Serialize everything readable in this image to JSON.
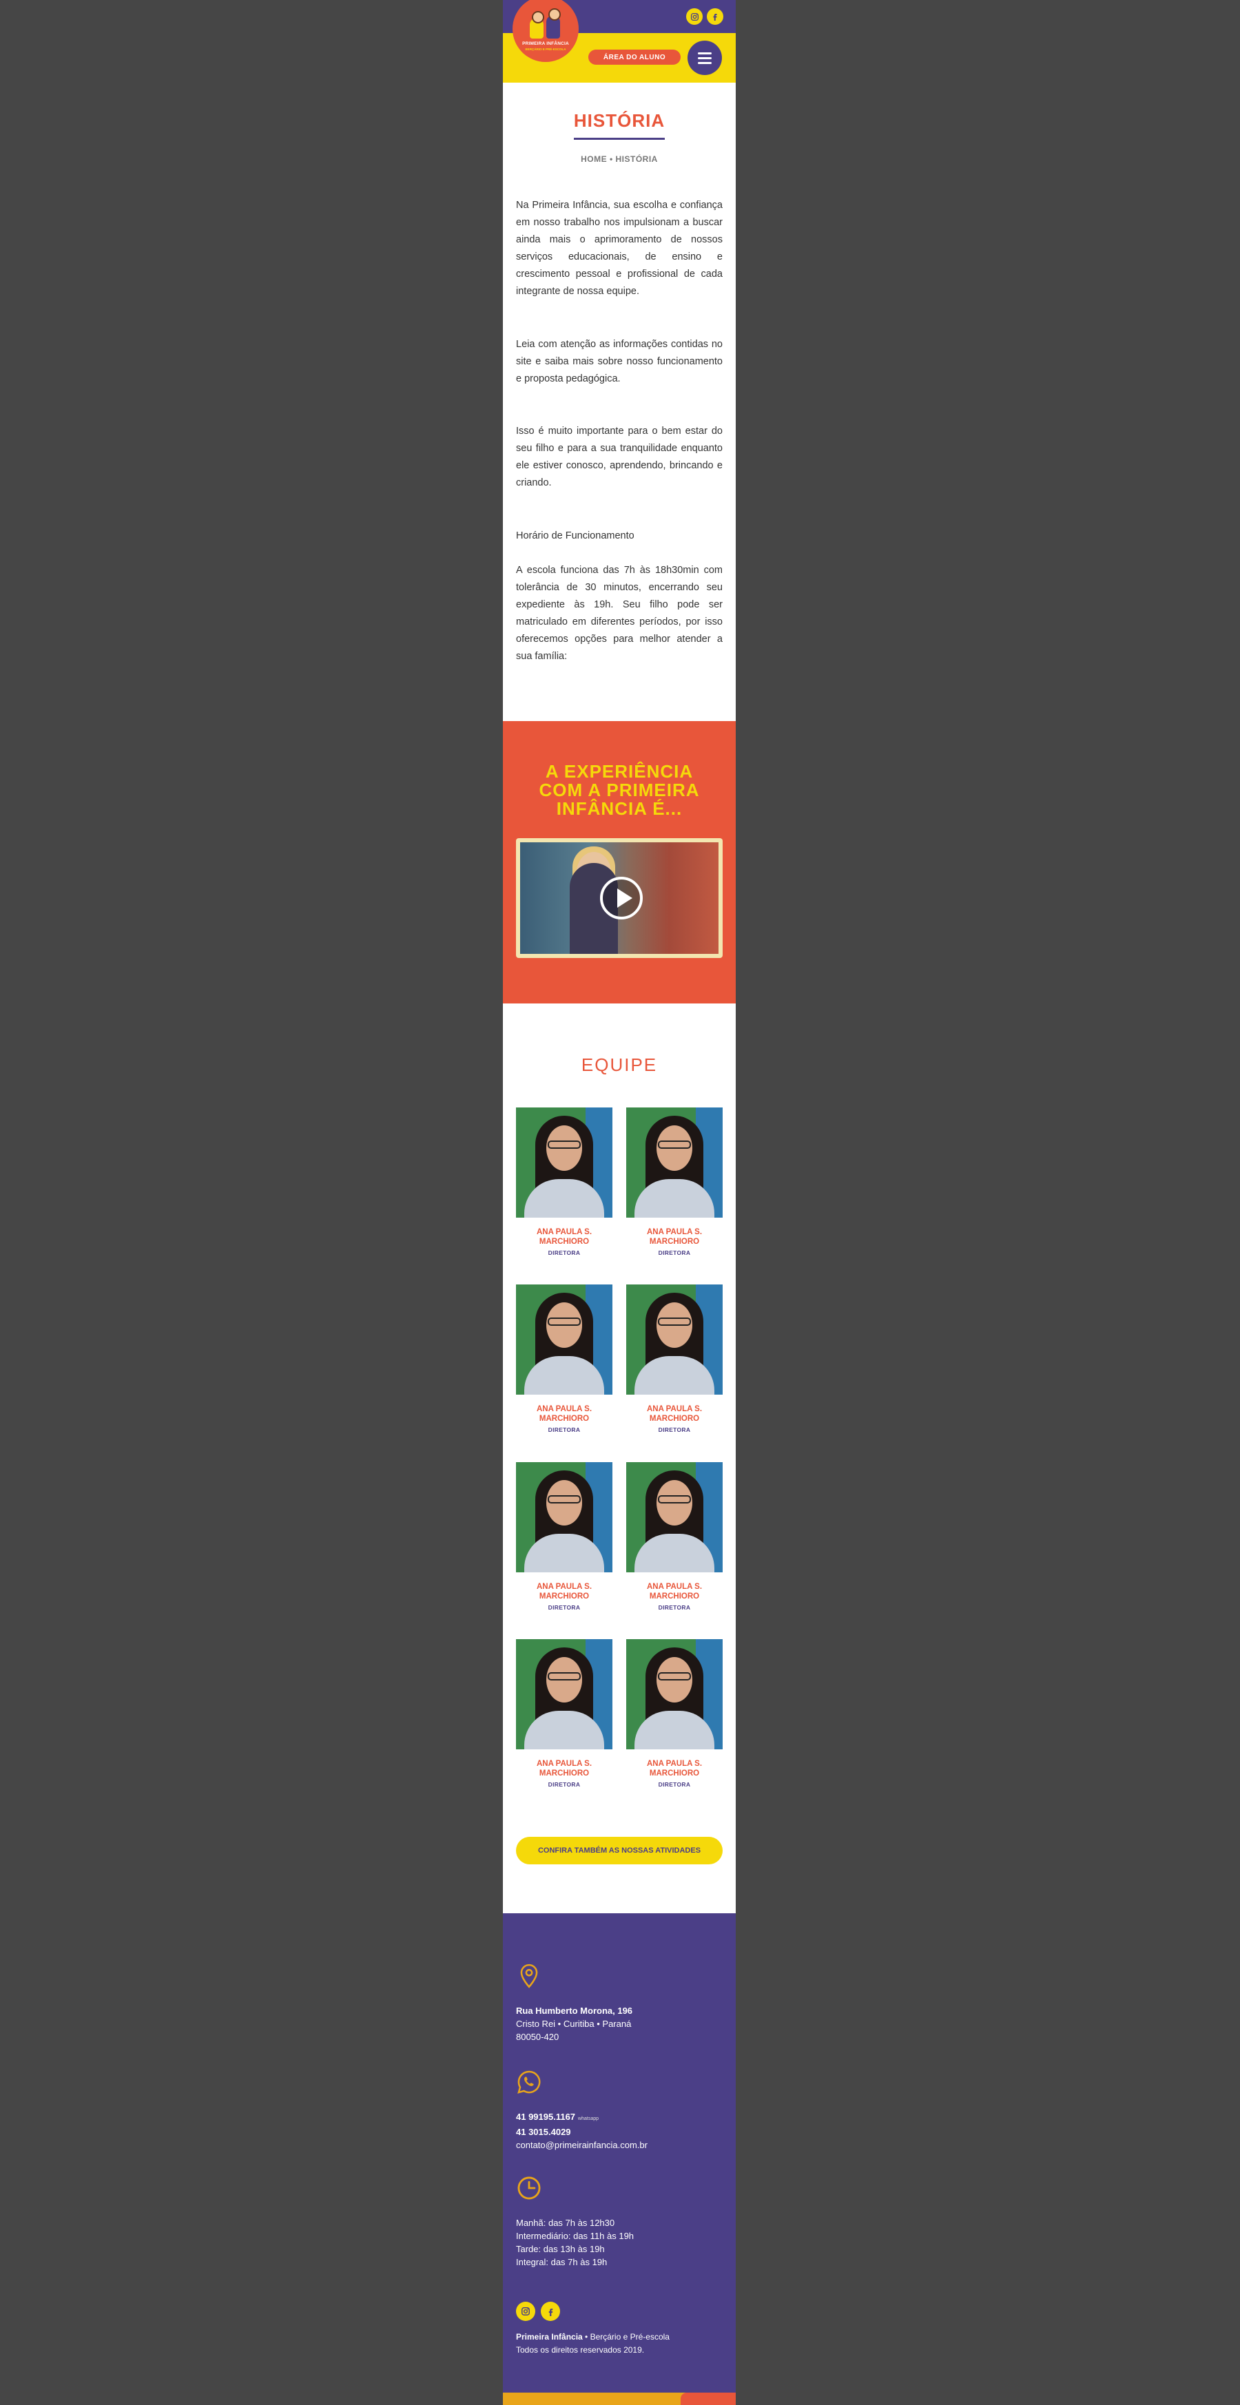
{
  "header": {
    "logo_name": "PRIMEIRA INFÂNCIA",
    "logo_sub": "BERÇÁRIO E PRÉ-ESCOLA",
    "area_button": "ÁREA DO ALUNO",
    "social": [
      "instagram-icon",
      "facebook-icon"
    ]
  },
  "historia": {
    "title": "HISTÓRIA",
    "breadcrumb": "HOME • HISTÓRIA",
    "paragraphs": [
      "Na Primeira Infância, sua escolha e confiança em nosso trabalho nos impulsionam a buscar ainda mais o aprimoramento de nossos serviços educacionais, de ensino e crescimento pessoal e profissional de cada integrante de nossa equipe.",
      "Leia com atenção as informações contidas no site e saiba mais sobre nosso funcionamento e proposta pedagógica.",
      "Isso é muito importante para o bem estar do seu filho e para a sua tranquilidade enquanto ele estiver conosco, aprendendo, brincando e criando.",
      "Horário de Funcionamento",
      "A escola funciona das 7h às 18h30min com tolerância de 30 minutos, encerrando seu expediente às 19h. Seu filho pode ser matriculado em diferentes períodos, por isso oferecemos opções para melhor atender a sua família:"
    ]
  },
  "video": {
    "title_lines": [
      "A EXPERIÊNCIA",
      "COM A PRIMEIRA",
      "INFÂNCIA É..."
    ]
  },
  "equipe": {
    "title": "EQUIPE",
    "members": [
      {
        "name_1": "ANA PAULA S.",
        "name_2": "MARCHIORO",
        "role": "DIRETORA"
      },
      {
        "name_1": "ANA PAULA S.",
        "name_2": "MARCHIORO",
        "role": "DIRETORA"
      },
      {
        "name_1": "ANA PAULA S.",
        "name_2": "MARCHIORO",
        "role": "DIRETORA"
      },
      {
        "name_1": "ANA PAULA S.",
        "name_2": "MARCHIORO",
        "role": "DIRETORA"
      },
      {
        "name_1": "ANA PAULA S.",
        "name_2": "MARCHIORO",
        "role": "DIRETORA"
      },
      {
        "name_1": "ANA PAULA S.",
        "name_2": "MARCHIORO",
        "role": "DIRETORA"
      },
      {
        "name_1": "ANA PAULA S.",
        "name_2": "MARCHIORO",
        "role": "DIRETORA"
      },
      {
        "name_1": "ANA PAULA S.",
        "name_2": "MARCHIORO",
        "role": "DIRETORA"
      }
    ],
    "activities_button": "CONFIRA TAMBÉM AS NOSSAS ATIVIDADES"
  },
  "footer": {
    "address_street": "Rua Humberto Morona, 196",
    "address_city": "Cristo Rei  •  Curitiba  •  Paraná",
    "address_zip": "80050-420",
    "phone_whatsapp": "41 99195.1167",
    "whatsapp_tag": "whatsapp",
    "phone": "41 3015.4029",
    "email": "contato@primeirainfancia.com.br",
    "hours": [
      "Manhã: das 7h às 12h30",
      "Intermediário: das 11h às 19h",
      "Tarde: das 13h às 19h",
      "Integral: das 7h às 19h"
    ],
    "copy_brand": "Primeira Infância",
    "copy_rest": "  •  Berçário e Pré-escola",
    "copy_line2": "Todos os direitos reservados 2019."
  },
  "colors": {
    "purple": "#4b3f87",
    "orange": "#e8563a",
    "yellow": "#f5d90a"
  }
}
